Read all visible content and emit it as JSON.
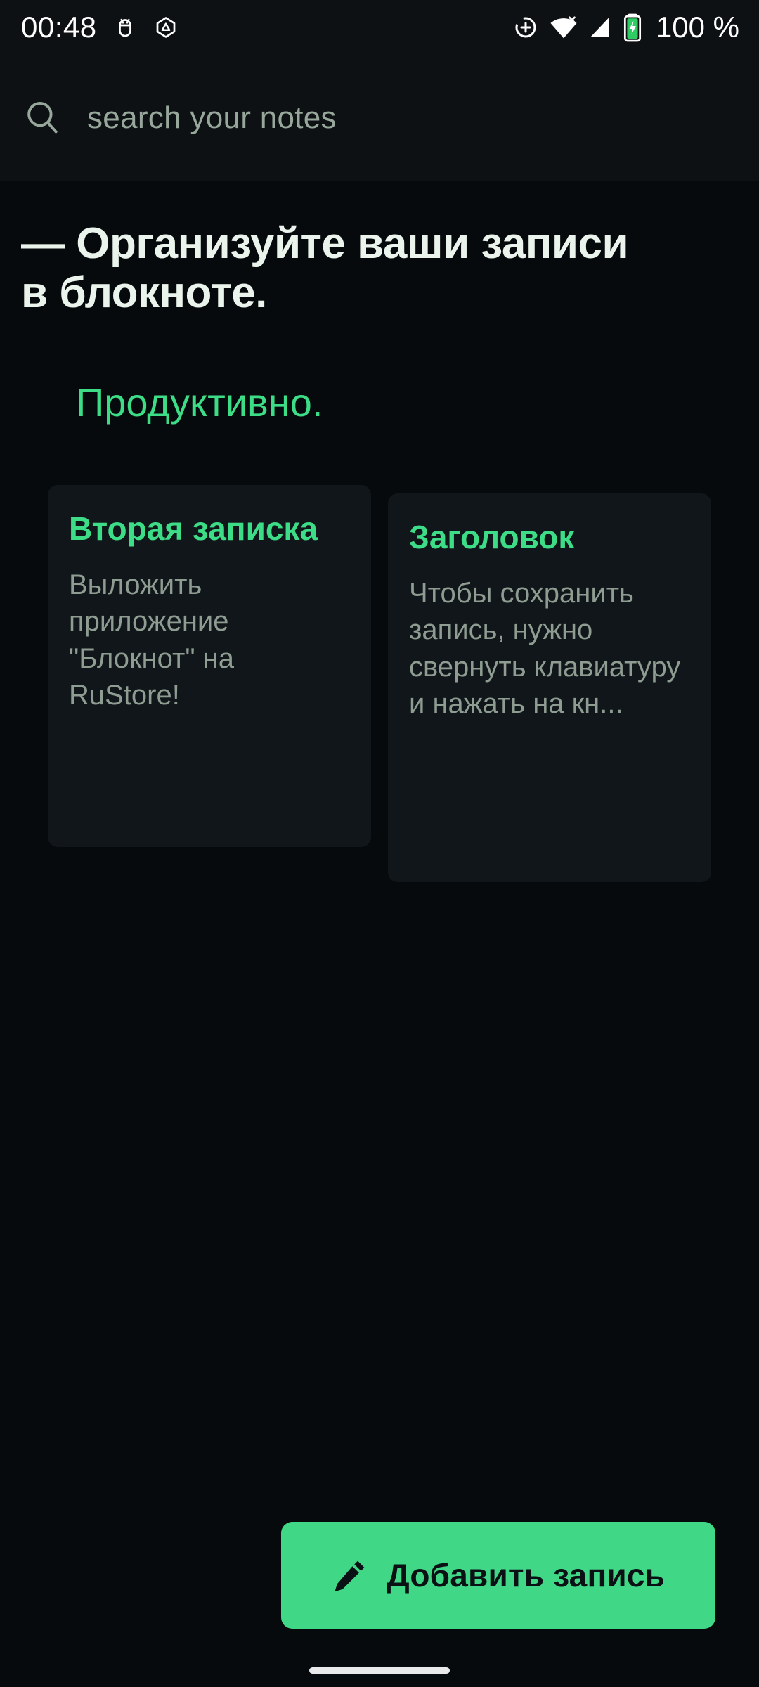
{
  "status_bar": {
    "time": "00:48",
    "battery_percent": "100 %",
    "left_icons": [
      {
        "name": "usb-debug-icon"
      },
      {
        "name": "developer-triangle-icon"
      }
    ],
    "right_icons": [
      {
        "name": "location-crosshair-icon"
      },
      {
        "name": "wifi-off-icon"
      },
      {
        "name": "cellular-signal-icon"
      },
      {
        "name": "battery-charging-icon"
      }
    ]
  },
  "search": {
    "placeholder": "search your notes",
    "value": "",
    "icon": "search-icon"
  },
  "hero": {
    "headline": "— Организуйте ваши записи в блокноте.",
    "subhead": "Продуктивно."
  },
  "notes": [
    {
      "title": "Вторая записка",
      "body": "Выложить приложение \"Блокнот\" на RuStore!"
    },
    {
      "title": "Заголовок",
      "body": "Чтобы сохранить запись, нужно свернуть клавиатуру и нажать на кн..."
    }
  ],
  "fab": {
    "label": "Добавить запись",
    "icon": "pencil-icon"
  },
  "colors": {
    "accent_green": "#3ddd88",
    "fab_green": "#40d887",
    "page_background": "#060a0c",
    "surface": "#0d1114",
    "card_background": "#11161a",
    "muted_text": "#8e9c91",
    "heading_text": "#eaf4ec"
  }
}
